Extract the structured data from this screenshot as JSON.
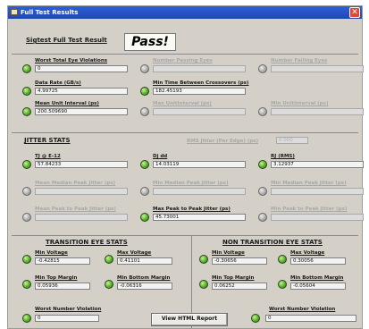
{
  "window": {
    "title": "Full Test Results",
    "close_glyph": "✕"
  },
  "header": {
    "label": "Sigtest Full Test Result",
    "result": "Pass!"
  },
  "top_section": {
    "left": [
      {
        "label": "Worst Total Eye Violations",
        "value": "0",
        "enabled": true
      },
      {
        "label": "Data Rate (GB/s)",
        "value": "4.99725",
        "enabled": true
      },
      {
        "label": "Mean Unit Interval (ps)",
        "value": "200.509690",
        "enabled": true
      }
    ],
    "mid": [
      {
        "label": "Number Passing Eyes",
        "value": "",
        "enabled": false
      },
      {
        "label": "Min Time Between Crossovers (ps)",
        "value": "182.45193",
        "enabled": true
      },
      {
        "label": "Max UnitInterval (ps)",
        "value": "",
        "enabled": false
      }
    ],
    "right": [
      {
        "label": "Number Failing Eyes",
        "value": "",
        "enabled": false
      },
      {
        "label": "Min UnitInterval (ps)",
        "value": "",
        "enabled": false
      }
    ]
  },
  "jitter": {
    "title": "JITTER STATS",
    "rms_label": "RMS Jitter (Per Edge) (ps)",
    "rms_value": "0.000",
    "cells": [
      {
        "label": "TJ @ E-12",
        "value": "57.84233",
        "enabled": true
      },
      {
        "label": "Dj dd",
        "value": "14.03119",
        "enabled": true
      },
      {
        "label": "RJ (RMS)",
        "value": "3.12937",
        "enabled": true
      },
      {
        "label": "Mean Median Peak Jitter (ps)",
        "value": "",
        "enabled": false
      },
      {
        "label": "Min Median Peak Jitter (ps)",
        "value": "",
        "enabled": false
      },
      {
        "label": "Min Median Peak Jitter (ps)",
        "value": "",
        "enabled": false
      },
      {
        "label": "Mean Peak to Peak Jitter (ps)",
        "value": "",
        "enabled": false
      },
      {
        "label": "Max Peak to Peak Jitter (ps)",
        "value": "45.73001",
        "enabled": true
      },
      {
        "label": "Min Peak to Peak Jitter (ps)",
        "value": "",
        "enabled": false
      }
    ]
  },
  "transition": {
    "title": "TRANSITION EYE STATS",
    "items": [
      {
        "label": "Min Voltage",
        "value": "-0.42815"
      },
      {
        "label": "Max Voltage",
        "value": "0.41101"
      },
      {
        "label": "Min Top Margin",
        "value": "0.05936"
      },
      {
        "label": "Min Bottom Margin",
        "value": "-0.06316"
      }
    ],
    "worst_label": "Worst Number Violation",
    "worst_value": "0"
  },
  "non_transition": {
    "title": "NON TRANSITION EYE STATS",
    "items": [
      {
        "label": "Min Voltage",
        "value": "-0.30656"
      },
      {
        "label": "Max Voltage",
        "value": "0.30056"
      },
      {
        "label": "Min Top Margin",
        "value": "0.06252"
      },
      {
        "label": "Min Bottom Margin",
        "value": "-0.05604"
      }
    ],
    "worst_label": "Worst Number Violation",
    "worst_value": "0"
  },
  "footer": {
    "html_button": "View HTML Report"
  }
}
